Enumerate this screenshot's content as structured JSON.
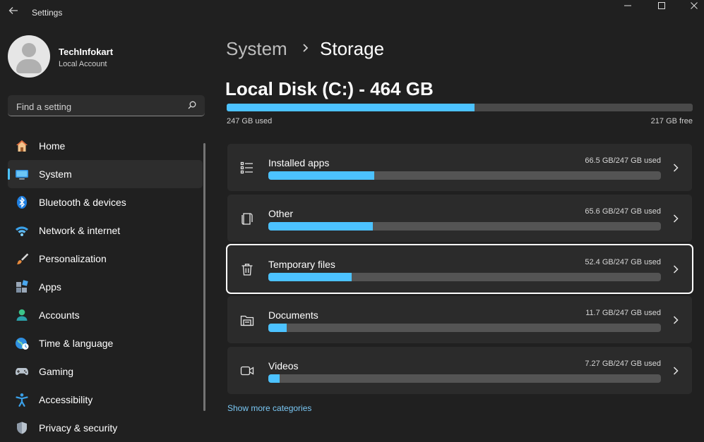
{
  "window": {
    "title": "Settings",
    "minimize": "—",
    "maximize": "☐",
    "close": "✕"
  },
  "profile": {
    "name": "TechInfokart",
    "account_type": "Local Account"
  },
  "search": {
    "placeholder": "Find a setting"
  },
  "sidebar": {
    "items": [
      {
        "label": "Home",
        "icon": "home-icon",
        "active": false
      },
      {
        "label": "System",
        "icon": "system-icon",
        "active": true
      },
      {
        "label": "Bluetooth & devices",
        "icon": "bluetooth-icon",
        "active": false
      },
      {
        "label": "Network & internet",
        "icon": "wifi-icon",
        "active": false
      },
      {
        "label": "Personalization",
        "icon": "brush-icon",
        "active": false
      },
      {
        "label": "Apps",
        "icon": "apps-icon",
        "active": false
      },
      {
        "label": "Accounts",
        "icon": "accounts-icon",
        "active": false
      },
      {
        "label": "Time & language",
        "icon": "globe-icon",
        "active": false
      },
      {
        "label": "Gaming",
        "icon": "gamepad-icon",
        "active": false
      },
      {
        "label": "Accessibility",
        "icon": "accessibility-icon",
        "active": false
      },
      {
        "label": "Privacy & security",
        "icon": "shield-icon",
        "active": false
      }
    ]
  },
  "breadcrumb": {
    "parent": "System",
    "current": "Storage"
  },
  "disk": {
    "title": "Local Disk (C:) - 464 GB",
    "used_label": "247 GB used",
    "free_label": "217 GB free",
    "used_fraction": 0.532
  },
  "categories": [
    {
      "label": "Installed apps",
      "size": "66.5 GB/247 GB used",
      "fraction": 0.269,
      "icon": "list-icon",
      "selected": false
    },
    {
      "label": "Other",
      "size": "65.6 GB/247 GB used",
      "fraction": 0.266,
      "icon": "document-icon",
      "selected": false
    },
    {
      "label": "Temporary files",
      "size": "52.4 GB/247 GB used",
      "fraction": 0.212,
      "icon": "trash-icon",
      "selected": true
    },
    {
      "label": "Documents",
      "size": "11.7 GB/247 GB used",
      "fraction": 0.047,
      "icon": "folder-icon",
      "selected": false
    },
    {
      "label": "Videos",
      "size": "7.27 GB/247 GB used",
      "fraction": 0.029,
      "icon": "video-icon",
      "selected": false
    }
  ],
  "show_more": "Show more categories",
  "colors": {
    "accent": "#4cc2ff",
    "background": "#202020",
    "card": "#2b2b2b"
  }
}
